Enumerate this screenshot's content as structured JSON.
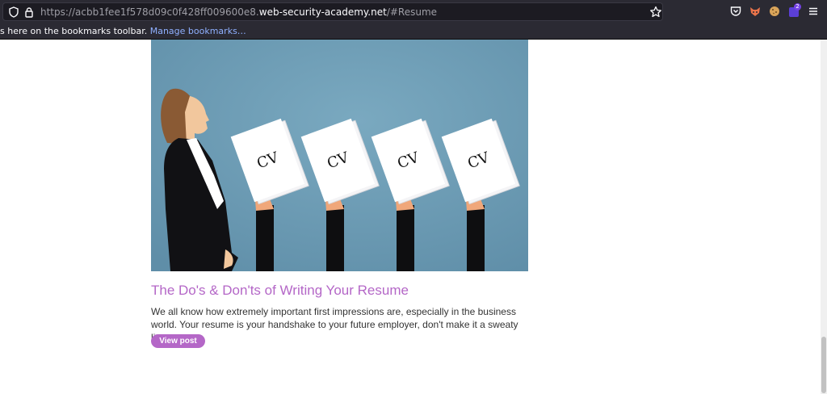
{
  "browser": {
    "url_prefix": "https://acbb1fee1f578d09c0f428ff009600e8.",
    "url_host": "web-security-academy.net",
    "url_suffix": "/#Resume",
    "extension_badge": "2",
    "bookmarks_hint": "s here on the bookmarks toolbar.",
    "bookmarks_link": "Manage bookmarks…"
  },
  "post": {
    "image_text": "CV",
    "title": "The Do's & Don'ts of Writing Your Resume",
    "summary": "We all know how extremely important first impressions are, especially in the business world. Your resume is your handshake to your future employer, don't make it a sweaty limp one.",
    "button_label": "View post"
  },
  "colors": {
    "accent": "#b467c7",
    "chrome": "#2b2a33",
    "image_bg": "#6e9db5"
  }
}
